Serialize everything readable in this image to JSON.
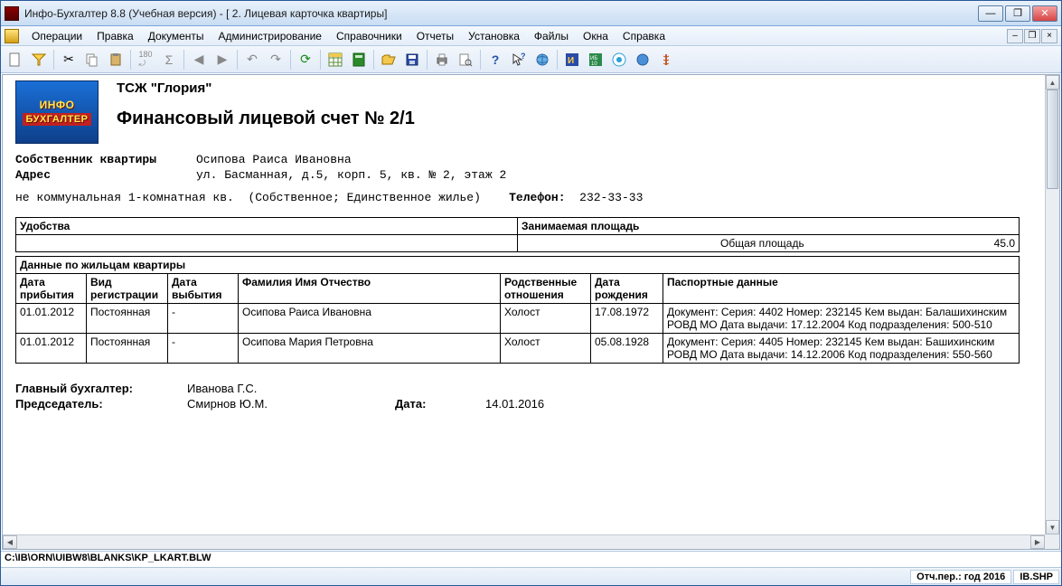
{
  "window": {
    "title": "Инфо-Бухгалтер 8.8 (Учебная версия) - [   2. Лицевая карточка квартиры]"
  },
  "menubar": [
    "Операции",
    "Правка",
    "Документы",
    "Администрирование",
    "Справочники",
    "Отчеты",
    "Установка",
    "Файлы",
    "Окна",
    "Справка"
  ],
  "doc": {
    "logo1": "ИНФО",
    "logo2": "БУХГАЛТЕР",
    "org": "ТСЖ \"Глория\"",
    "title": "Финансовый лицевой счет № 2/1",
    "owner_label": "Собственник квартиры",
    "owner_value": "Осипова Раиса Ивановна",
    "address_label": "Адрес",
    "address_value": "ул. Басманная, д.5, корп. 5, кв. № 2, этаж 2",
    "line1_a": "не коммунальная 1-комнатная кв.",
    "line1_b": "(Собственное; Единственное жилье)",
    "phone_label": "Телефон:",
    "phone_value": "232-33-33",
    "amen_header": "Удобства",
    "area_header": "Занимаемая площадь",
    "total_area_label": "Общая площадь",
    "total_area_value": "45.0",
    "residents_header": "Данные по жильцам квартиры",
    "cols": {
      "c1": "Дата прибытия",
      "c2": "Вид регистрации",
      "c3": "Дата выбытия",
      "c4": "Фамилия Имя Отчество",
      "c5": "Родственные отношения",
      "c6": "Дата рождения",
      "c7": "Паспортные данные"
    },
    "rows": [
      {
        "arrival": "01.01.2012",
        "reg": "Постоянная",
        "leave": "-",
        "fio": "Осипова Раиса Ивановна",
        "rel": "Холост",
        "dob": "17.08.1972",
        "passport": "Документ:  Серия: 4402 Номер: 232145 Кем выдан: Балашихинским РОВД МО Дата выдачи: 17.12.2004 Код подразделения: 500-510"
      },
      {
        "arrival": "01.01.2012",
        "reg": "Постоянная",
        "leave": "-",
        "fio": "Осипова Мария Петровна",
        "rel": "Холост",
        "dob": "05.08.1928",
        "passport": "Документ:  Серия: 4405 Номер: 232145 Кем выдан: Башихинским РОВД МО Дата выдачи: 14.12.2006 Код подразделения: 550-560"
      }
    ],
    "chief_accountant_label": "Главный бухгалтер:",
    "chief_accountant": "Иванова Г.С.",
    "chairman_label": "Председатель:",
    "chairman": "Смирнов Ю.М.",
    "date_label": "Дата:",
    "date_value": "14.01.2016"
  },
  "path": "C:\\IB\\ORN\\UIBW8\\BLANKS\\KP_LKART.BLW",
  "status": {
    "period": "Отч.пер.: год 2016",
    "file": "IB.SHP"
  }
}
